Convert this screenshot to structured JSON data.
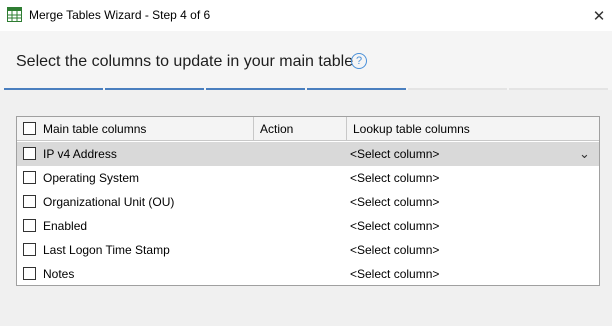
{
  "window": {
    "title": "Merge Tables Wizard - Step 4 of 6",
    "close_glyph": "✕",
    "icon": "merge-tables-app-icon"
  },
  "page": {
    "heading": "Select the columns to update in your main table",
    "help_glyph": "?"
  },
  "progress": {
    "total_steps": 6,
    "current_step": 4
  },
  "grid": {
    "headers": {
      "main": "Main table columns",
      "action": "Action",
      "lookup": "Lookup table columns"
    },
    "rows": [
      {
        "name": "IP v4 Address",
        "lookup": "<Select column>",
        "checked": false,
        "selected": true
      },
      {
        "name": "Operating System",
        "lookup": "<Select column>",
        "checked": false,
        "selected": false
      },
      {
        "name": "Organizational Unit (OU)",
        "lookup": "<Select column>",
        "checked": false,
        "selected": false
      },
      {
        "name": "Enabled",
        "lookup": "<Select column>",
        "checked": false,
        "selected": false
      },
      {
        "name": "Last Logon Time Stamp",
        "lookup": "<Select column>",
        "checked": false,
        "selected": false
      },
      {
        "name": "Notes",
        "lookup": "<Select column>",
        "checked": false,
        "selected": false
      }
    ],
    "dropdown_glyph": "⌄"
  },
  "colors": {
    "progress_done": "#4a7fbf",
    "progress_todo": "#e4e4e4",
    "selected_row": "#d9d9d9",
    "help_accent": "#4a90d9"
  }
}
